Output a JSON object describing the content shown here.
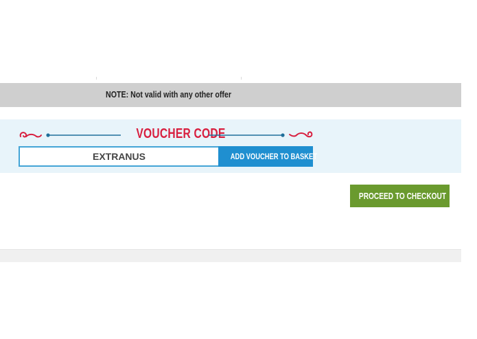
{
  "note": {
    "text": "NOTE: Not valid with any other offer"
  },
  "voucher": {
    "heading": "VOUCHER CODE",
    "input_value": "EXTRANUS",
    "add_button_label": "ADD VOUCHER TO BASKET"
  },
  "checkout": {
    "button_label": "PROCEED TO CHECKOUT",
    "icon": "chevron-right-icon"
  },
  "colors": {
    "heading_red": "#d81f3f",
    "voucher_blue": "#1f8fd0",
    "input_border": "#43a4d6",
    "panel_bg": "#e8f4fa",
    "note_bg": "#cfcfcf",
    "checkout_green": "#6a9a2e"
  }
}
